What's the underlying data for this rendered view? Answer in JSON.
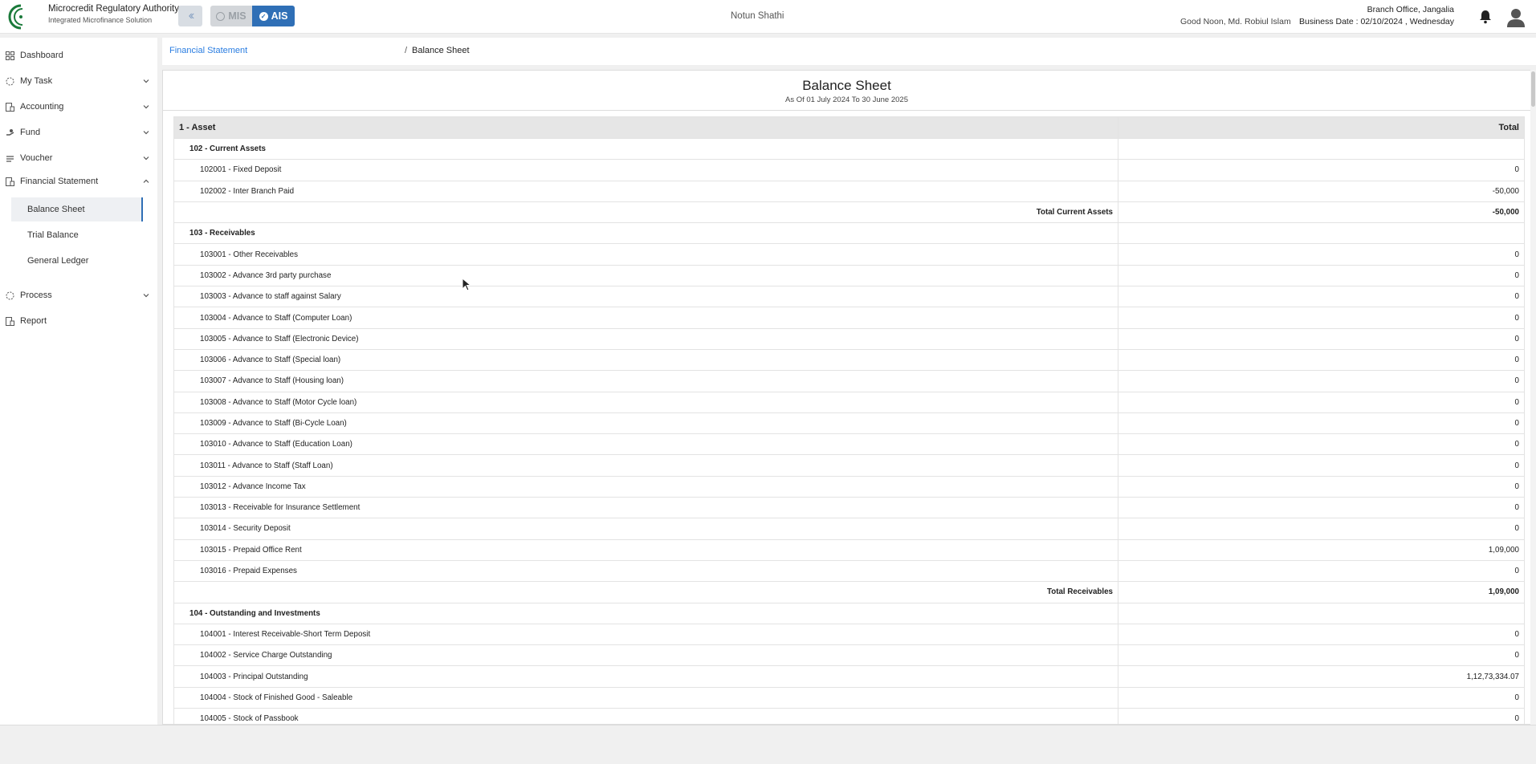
{
  "header": {
    "brand_name": "Microcredit Regulatory Authority",
    "brand_sub": "Integrated Microfinance Solution",
    "logo_text": "Microcredit Regulatory Authority",
    "mode_mis": "MIS",
    "mode_ais": "AIS",
    "org_name": "Notun Shathi",
    "greeting": "Good Noon, Md. Robiul Islam",
    "branch": "Branch Office, Jangalia",
    "business_date": "Business Date : 02/10/2024 , Wednesday",
    "accent_color": "#2f6fb6"
  },
  "sidebar": {
    "items": [
      {
        "label": "Dashboard",
        "icon": "grid-icon"
      },
      {
        "label": "My Task",
        "icon": "task-icon"
      },
      {
        "label": "Accounting",
        "icon": "accounting-icon"
      },
      {
        "label": "Fund",
        "icon": "fund-icon"
      },
      {
        "label": "Voucher",
        "icon": "voucher-icon"
      },
      {
        "label": "Financial Statement",
        "icon": "statement-icon"
      },
      {
        "label": "Process",
        "icon": "process-icon"
      },
      {
        "label": "Report",
        "icon": "report-icon"
      }
    ],
    "sub_items": [
      "Balance Sheet",
      "Trial Balance",
      "General Ledger"
    ],
    "active_sub": "Balance Sheet"
  },
  "breadcrumb": {
    "parent": "Financial Statement",
    "separator": "/",
    "current": "Balance Sheet"
  },
  "report": {
    "title": "Balance Sheet",
    "subtitle": "As Of 01 July 2024 To 30 June 2025",
    "header_label": "1 - Asset",
    "header_value": "Total",
    "rows": [
      {
        "type": "group",
        "label": "102 - Current Assets",
        "value": ""
      },
      {
        "type": "acct",
        "label": "102001 - Fixed Deposit",
        "value": "0"
      },
      {
        "type": "acct",
        "label": "102002 - Inter Branch Paid",
        "value": "-50,000"
      },
      {
        "type": "total",
        "label": "Total Current Assets",
        "value": "-50,000"
      },
      {
        "type": "group",
        "label": "103 - Receivables",
        "value": ""
      },
      {
        "type": "acct",
        "label": "103001 - Other Receivables",
        "value": "0"
      },
      {
        "type": "acct",
        "label": "103002 - Advance 3rd party purchase",
        "value": "0"
      },
      {
        "type": "acct",
        "label": "103003 - Advance to staff against Salary",
        "value": "0"
      },
      {
        "type": "acct",
        "label": "103004 - Advance to Staff (Computer Loan)",
        "value": "0"
      },
      {
        "type": "acct",
        "label": "103005 - Advance to Staff (Electronic Device)",
        "value": "0"
      },
      {
        "type": "acct",
        "label": "103006 - Advance to Staff (Special loan)",
        "value": "0"
      },
      {
        "type": "acct",
        "label": "103007 - Advance to Staff (Housing loan)",
        "value": "0"
      },
      {
        "type": "acct",
        "label": "103008 - Advance to Staff (Motor Cycle loan)",
        "value": "0"
      },
      {
        "type": "acct",
        "label": "103009 - Advance to Staff (Bi-Cycle Loan)",
        "value": "0"
      },
      {
        "type": "acct",
        "label": "103010 - Advance to Staff (Education Loan)",
        "value": "0"
      },
      {
        "type": "acct",
        "label": "103011 - Advance to Staff (Staff Loan)",
        "value": "0"
      },
      {
        "type": "acct",
        "label": "103012 - Advance Income Tax",
        "value": "0"
      },
      {
        "type": "acct",
        "label": "103013 - Receivable for Insurance Settlement",
        "value": "0"
      },
      {
        "type": "acct",
        "label": "103014 - Security Deposit",
        "value": "0"
      },
      {
        "type": "acct",
        "label": "103015 - Prepaid Office Rent",
        "value": "1,09,000"
      },
      {
        "type": "acct",
        "label": "103016 - Prepaid Expenses",
        "value": "0"
      },
      {
        "type": "total",
        "label": "Total Receivables",
        "value": "1,09,000"
      },
      {
        "type": "group",
        "label": "104 - Outstanding and Investments",
        "value": ""
      },
      {
        "type": "acct",
        "label": "104001 - Interest Receivable-Short Term Deposit",
        "value": "0"
      },
      {
        "type": "acct",
        "label": "104002 - Service Charge Outstanding",
        "value": "0"
      },
      {
        "type": "acct",
        "label": "104003 - Principal Outstanding",
        "value": "1,12,73,334.07"
      },
      {
        "type": "acct",
        "label": "104004 - Stock of Finished Good - Saleable",
        "value": "0"
      },
      {
        "type": "acct",
        "label": "104005 - Stock of Passbook",
        "value": "0"
      }
    ]
  }
}
